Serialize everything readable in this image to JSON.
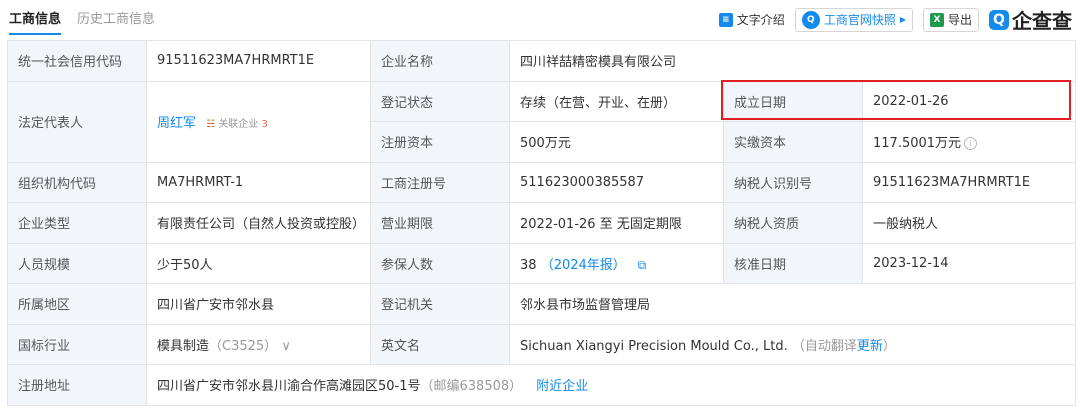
{
  "tabs": {
    "active": "工商信息",
    "inactive": "历史工商信息"
  },
  "actions": {
    "text_intro": "文字介绍",
    "official_snapshot": "工商官网快照",
    "export": "导出",
    "brand": "企查查"
  },
  "rows": {
    "credit_code": {
      "label": "统一社会信用代码",
      "value": "91511623MA7HRMRT1E"
    },
    "company_name": {
      "label": "企业名称",
      "value": "四川祥喆精密模具有限公司"
    },
    "legal_rep": {
      "label": "法定代表人",
      "value": "周红军",
      "related_label": "关联企业",
      "related_count": "3"
    },
    "reg_status": {
      "label": "登记状态",
      "value": "存续（在营、开业、在册）"
    },
    "founded": {
      "label": "成立日期",
      "value": "2022-01-26"
    },
    "reg_capital": {
      "label": "注册资本",
      "value": "500万元"
    },
    "paid_capital": {
      "label": "实缴资本",
      "value": "117.5001万元"
    },
    "org_code": {
      "label": "组织机构代码",
      "value": "MA7HRMRT-1"
    },
    "biz_reg_no": {
      "label": "工商注册号",
      "value": "511623000385587"
    },
    "taxpayer_id": {
      "label": "纳税人识别号",
      "value": "91511623MA7HRMRT1E"
    },
    "company_type": {
      "label": "企业类型",
      "value": "有限责任公司（自然人投资或控股）"
    },
    "biz_term": {
      "label": "营业期限",
      "value": "2022-01-26 至 无固定期限"
    },
    "taxpayer_qual": {
      "label": "纳税人资质",
      "value": "一般纳税人"
    },
    "staff_size": {
      "label": "人员规模",
      "value": "少于50人"
    },
    "insured": {
      "label": "参保人数",
      "value": "38",
      "year_note": "（2024年报）"
    },
    "approval_date": {
      "label": "核准日期",
      "value": "2023-12-14"
    },
    "region": {
      "label": "所属地区",
      "value": "四川省广安市邻水县"
    },
    "reg_authority": {
      "label": "登记机关",
      "value": "邻水县市场监督管理局"
    },
    "industry": {
      "label": "国标行业",
      "value": "模具制造",
      "code": "（C3525）"
    },
    "english_name": {
      "label": "英文名",
      "value": "Sichuan Xiangyi Precision Mould Co., Ltd.",
      "note": "（自动翻译",
      "update": "更新",
      "note_end": "）"
    },
    "address": {
      "label": "注册地址",
      "value": "四川省广安市邻水县川渝合作高滩园区50-1号",
      "postcode": "（邮编638508）",
      "nearby": "附近企业"
    }
  }
}
